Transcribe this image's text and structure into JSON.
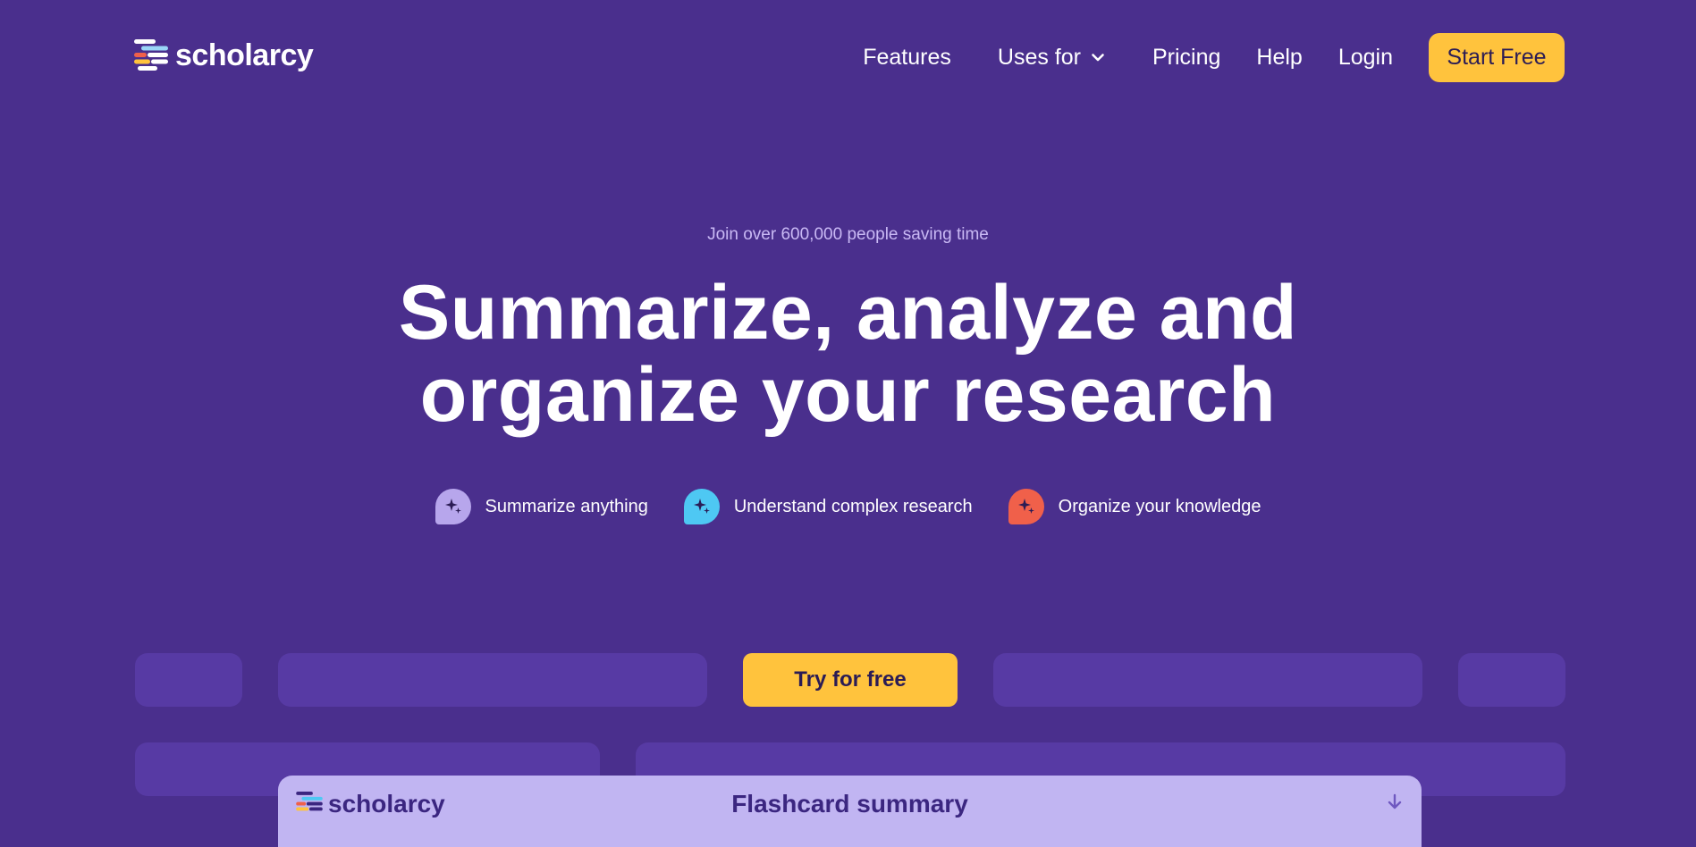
{
  "brand": {
    "name": "scholarcy",
    "colors": {
      "background": "#4a2f8d",
      "accent": "#ffc33d",
      "panel": "#573aa4",
      "eyebrow": "#c9b9f4"
    }
  },
  "nav": {
    "links": [
      {
        "label": "Features"
      },
      {
        "label": "Uses for",
        "icon": "chevron-down-icon"
      },
      {
        "label": "Pricing"
      },
      {
        "label": "Help"
      },
      {
        "label": "Login"
      }
    ],
    "cta_label": "Start Free"
  },
  "hero": {
    "eyebrow": "Join over 600,000 people saving time",
    "headline_line1": "Summarize, analyze and",
    "headline_line2": "organize your research",
    "features": [
      {
        "label": "Summarize anything",
        "icon": "sparkle-icon",
        "color": "#b7a6ec"
      },
      {
        "label": "Understand complex research",
        "icon": "sparkle-icon",
        "color": "#4ec8f3"
      },
      {
        "label": "Organize your knowledge",
        "icon": "sparkle-icon",
        "color": "#f0604a"
      }
    ],
    "try_label": "Try for free"
  },
  "preview": {
    "logo_text": "scholarcy",
    "title": "Flashcard summary",
    "download_icon": "download-icon"
  }
}
